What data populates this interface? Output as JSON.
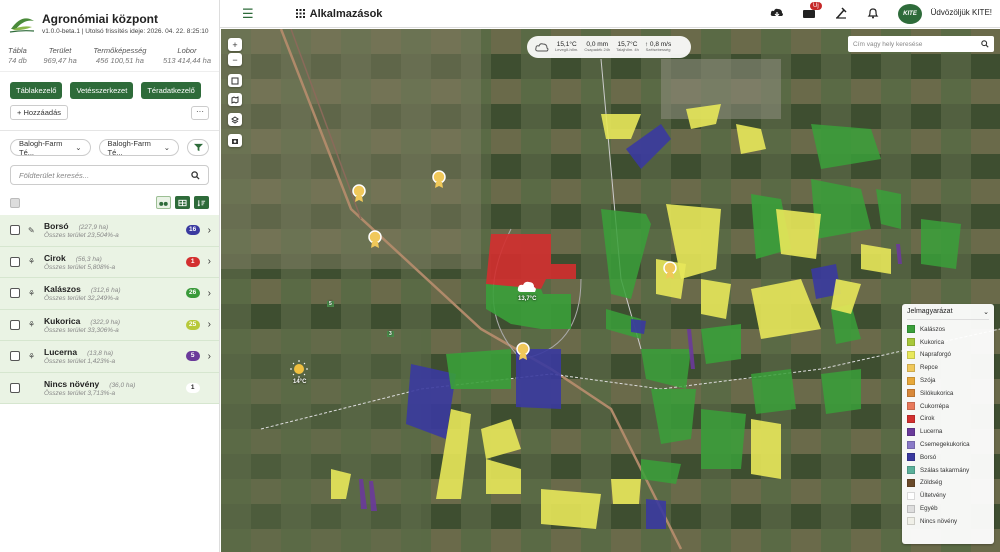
{
  "brand": {
    "title": "Agronómiai központ",
    "version": "v1.0.0-beta.1 | Utolsó frissítés ideje: 2026. 04. 22. 8:25:10"
  },
  "stats": [
    {
      "label": "Tábla",
      "value": "74 db"
    },
    {
      "label": "Terület",
      "value": "969,47 ha"
    },
    {
      "label": "Termőképesség",
      "value": "456 100,51 ha"
    },
    {
      "label": "Lobor",
      "value": "513 414,44 ha"
    }
  ],
  "buttons": {
    "tablakezelo": "Táblakezelő",
    "vetesszerkezet": "Vetésszerkezet",
    "teradatkezelo": "Téradatkezelő",
    "hozzaadas": "+ Hozzáadás",
    "more": "···"
  },
  "filters": {
    "farm1": "Balogh-Farm Té...",
    "farm2": "Balogh-Farm Té..."
  },
  "search": {
    "placeholder": "Földterület keresés..."
  },
  "crops": [
    {
      "name": "Borsó",
      "area": "(227,9 ha)",
      "pct": "Összes terület 23,504%-a",
      "count": "16",
      "badge_color": "#3a3aa0",
      "icon": "✎"
    },
    {
      "name": "Cirok",
      "area": "(56,3 ha)",
      "pct": "Összes terület 5,808%-a",
      "count": "1",
      "badge_color": "#d32f2f",
      "icon": "⚘"
    },
    {
      "name": "Kalászos",
      "area": "(312,6 ha)",
      "pct": "Összes terület 32,249%-a",
      "count": "26",
      "badge_color": "#3a9a3a",
      "icon": "⚘"
    },
    {
      "name": "Kukorica",
      "area": "(322,9 ha)",
      "pct": "Összes terület 33,306%-a",
      "count": "25",
      "badge_color": "#b7c93a",
      "icon": "⚘"
    },
    {
      "name": "Lucerna",
      "area": "(13,8 ha)",
      "pct": "Összes terület 1,423%-a",
      "count": "5",
      "badge_color": "#6a3a9a",
      "icon": "⚘"
    },
    {
      "name": "Nincs növény",
      "area": "(36,0 ha)",
      "pct": "Összes terület 3,713%-a",
      "count": "1",
      "badge_color": "#ffffff",
      "icon": ""
    }
  ],
  "topbar": {
    "apps": "Alkalmazások",
    "new_badge": "Új",
    "welcome": "Üdvözöljük KITE!",
    "kite_logo": "KITE"
  },
  "weather": [
    {
      "value": "15,1°C",
      "label": "Levegő-hőm."
    },
    {
      "value": "0,0 mm",
      "label": "Csapadék 24h"
    },
    {
      "value": "15,7°C",
      "label": "Talajhőm. 4h"
    },
    {
      "value": "0,8 m/s",
      "label": "Szélsebesség"
    }
  ],
  "map": {
    "search_placeholder": "Cím vagy hely keresése",
    "temp_cloud": "13,7°C",
    "temp_sun": "14°C"
  },
  "legend": {
    "title": "Jelmagyarázat",
    "items": [
      {
        "label": "Kalászos",
        "color": "#3aa03a"
      },
      {
        "label": "Kukorica",
        "color": "#a8c83a"
      },
      {
        "label": "Napraforgó",
        "color": "#e8e85a"
      },
      {
        "label": "Repce",
        "color": "#f0c85a"
      },
      {
        "label": "Szója",
        "color": "#e8a83a"
      },
      {
        "label": "Silókukorica",
        "color": "#d8883a"
      },
      {
        "label": "Cukorrépa",
        "color": "#e8785a"
      },
      {
        "label": "Cirok",
        "color": "#d32f2f"
      },
      {
        "label": "Lucerna",
        "color": "#6a3a9a"
      },
      {
        "label": "Csemegekukorica",
        "color": "#8a7ac8"
      },
      {
        "label": "Borsó",
        "color": "#3a3aa0"
      },
      {
        "label": "Szálas takarmány",
        "color": "#5ab09a"
      },
      {
        "label": "Zöldség",
        "color": "#6a4a2a"
      },
      {
        "label": "Ültetvény",
        "color": "#ffffff"
      },
      {
        "label": "Egyéb",
        "color": "#dddddd"
      },
      {
        "label": "Nincs növény",
        "color": "#f0f0e8"
      }
    ]
  },
  "road_labels": [
    "3",
    "5",
    "5",
    "3"
  ]
}
